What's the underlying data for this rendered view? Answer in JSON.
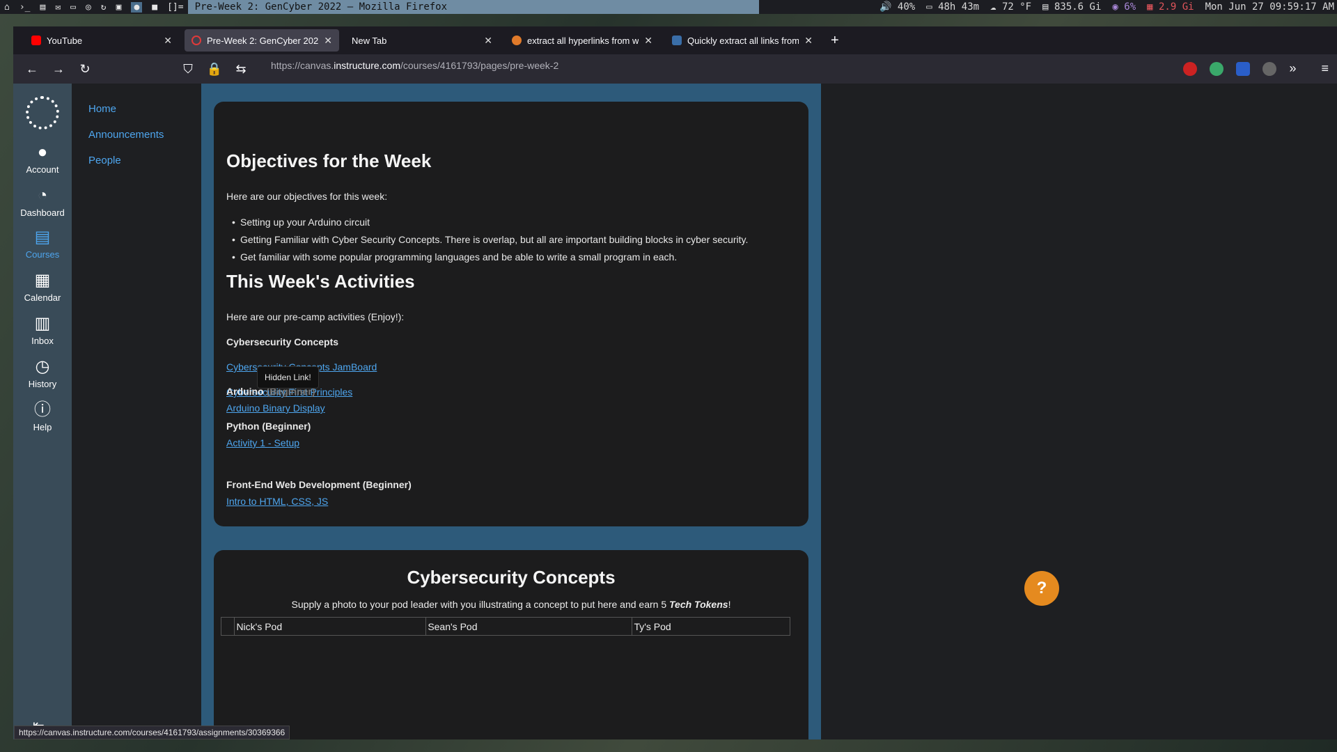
{
  "system_bar": {
    "window_title": "Pre-Week 2: GenCyber 2022 — Mozilla Firefox",
    "volume": "40%",
    "uptime": "48h 43m",
    "weather": "72 °F",
    "disk": "835.6 Gi",
    "cpu": "6%",
    "memory": "2.9 Gi",
    "datetime": "Mon Jun 27 09:59:17 AM"
  },
  "tabs": [
    {
      "label": "YouTube",
      "color": "#ff0000"
    },
    {
      "label": "Pre-Week 2: GenCyber 2022",
      "color": "#e03a3a"
    },
    {
      "label": "New Tab",
      "color": ""
    },
    {
      "label": "extract all hyperlinks from w",
      "color": "#e07a2a"
    },
    {
      "label": "Quickly extract all links from",
      "color": "#3a6ea8"
    }
  ],
  "url": {
    "prefix": "https://canvas.",
    "domain": "instructure.com",
    "path": "/courses/4161793/pages/pre-week-2"
  },
  "global_nav": {
    "account": "Account",
    "dashboard": "Dashboard",
    "courses": "Courses",
    "calendar": "Calendar",
    "inbox": "Inbox",
    "history": "History",
    "help": "Help"
  },
  "course_nav": {
    "home": "Home",
    "announcements": "Announcements",
    "people": "People"
  },
  "content": {
    "objectives_title": "Objectives for the Week",
    "objectives_intro": "Here are our objectives for this week:",
    "objectives": [
      "Setting up your Arduino circuit",
      "Getting Familiar with Cyber Security Concepts.  There is overlap, but all are important building blocks in cyber security.",
      "Get familiar with some popular programming languages and be able to write a small program in each."
    ],
    "activities_title": "This Week's Activities",
    "activities_intro": "Here are our pre-camp activities (Enjoy!):",
    "cyber_heading": "Cybersecurity  Concepts",
    "cyber_link1": "Cybersecurity Concepts JamBoard",
    "cyber_link2": "Cybersecurity First Principles",
    "arduino_heading": "Arduino",
    "arduino_level": "(Beginner)",
    "tooltip": "Hidden Link!",
    "arduino_link": "Arduino Binary Display",
    "python_heading": "Python (Beginner)",
    "python_link": "Activity 1 - Setup",
    "web_heading": "Front-End Web Development (Beginner)",
    "web_link": "Intro to HTML, CSS, JS"
  },
  "card2": {
    "title": "Cybersecurity Concepts",
    "subtitle_pre": "Supply a photo to your pod leader with you illustrating a concept to put here and earn 5 ",
    "subtitle_em": "Tech Tokens",
    "subtitle_post": "!",
    "pods": [
      "",
      "Nick's Pod",
      "Sean's Pod",
      "Ty's Pod"
    ]
  },
  "status_url": "https://canvas.instructure.com/courses/4161793/assignments/30369366",
  "colors": {
    "link": "#4ea6ef",
    "content_bg": "#2d5a7a",
    "global_nav": "#394b58",
    "help_fab": "#e58a1f"
  }
}
